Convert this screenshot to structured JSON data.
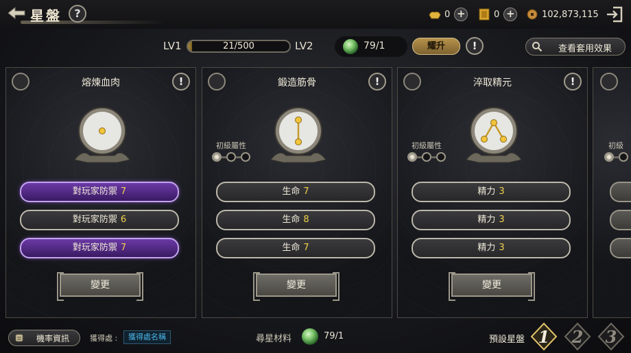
{
  "header": {
    "title": "星盤",
    "help_label": "?",
    "currencies": [
      {
        "icon": "gold-ingot-icon",
        "value": "0"
      },
      {
        "icon": "ticket-icon",
        "value": "0"
      },
      {
        "icon": "coin-icon",
        "value": "102,873,115"
      }
    ]
  },
  "level": {
    "lv_from": "LV1",
    "lv_to": "LV2",
    "exp_text": "21/500",
    "exp_progress": 0.042,
    "stone_count": "79/1",
    "upgrade_label": "耀升",
    "warn_label": "!",
    "set_effect_label": "查看套用效果"
  },
  "panels": [
    {
      "title": "熔煉血肉",
      "warn": "!",
      "constellation": "single-star",
      "attr_label": "",
      "stats": [
        {
          "name": "對玩家防禦",
          "value": "7",
          "style": "purple"
        },
        {
          "name": "對玩家防禦",
          "value": "6",
          "style": "normal"
        },
        {
          "name": "對玩家防禦",
          "value": "7",
          "style": "purple"
        }
      ],
      "change_label": "變更"
    },
    {
      "title": "鍛造筋骨",
      "warn": "!",
      "constellation": "two-stars",
      "attr_label": "初級屬性",
      "stats": [
        {
          "name": "生命",
          "value": "7",
          "style": "normal"
        },
        {
          "name": "生命",
          "value": "8",
          "style": "normal"
        },
        {
          "name": "生命",
          "value": "7",
          "style": "normal"
        }
      ],
      "change_label": "變更"
    },
    {
      "title": "淬取精元",
      "warn": "!",
      "constellation": "three-stars",
      "attr_label": "初級屬性",
      "stats": [
        {
          "name": "精力",
          "value": "3",
          "style": "normal"
        },
        {
          "name": "精力",
          "value": "3",
          "style": "normal"
        },
        {
          "name": "精力",
          "value": "3",
          "style": "normal"
        }
      ],
      "change_label": "變更"
    }
  ],
  "panel4": {
    "attr_label": "初級"
  },
  "footer": {
    "probability_label": "機率資訊",
    "obtain_label": "獲得處 :",
    "obtain_link": "獲得處名稱",
    "material_label": "尋星材料",
    "material_count": "79/1",
    "preset_label": "預設星盤",
    "presets": [
      "1",
      "2",
      "3"
    ]
  },
  "colors": {
    "accent_gold": "#f3d24a",
    "purple_stat": "#6b3aa6",
    "link_blue": "#4ab6e8"
  }
}
